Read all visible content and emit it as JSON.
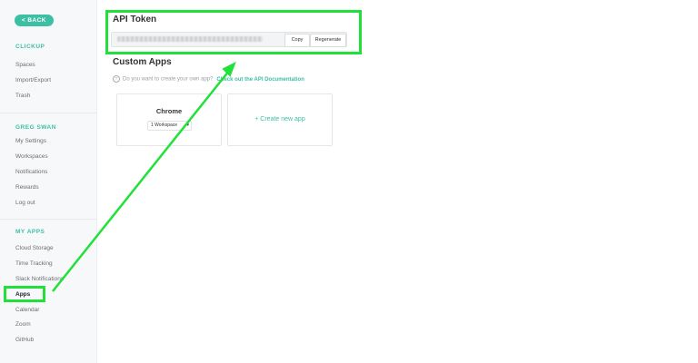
{
  "sidebar": {
    "back_label": "< BACK",
    "sections": [
      {
        "heading": "CLICKUP",
        "items": [
          "Spaces",
          "Import/Export",
          "Trash"
        ]
      },
      {
        "heading": "GREG SWAN",
        "items": [
          "My Settings",
          "Workspaces",
          "Notifications",
          "Rewards",
          "Log out"
        ]
      },
      {
        "heading": "MY APPS",
        "items": [
          "Cloud Storage",
          "Time Tracking",
          "Slack Notifications",
          "Apps",
          "Calendar",
          "Zoom",
          "GitHub"
        ]
      }
    ],
    "active_item": "Apps"
  },
  "api_token": {
    "title": "API Token",
    "copy_label": "Copy",
    "regenerate_label": "Regenerate"
  },
  "custom_apps": {
    "title": "Custom Apps",
    "info_text": "Do you want to create your own app?",
    "doc_link": "Check out the API Documentation",
    "cards": {
      "chrome": {
        "name": "Chrome",
        "workspace_select": "1 Workspace"
      },
      "create_label": "+ Create new app"
    }
  },
  "colors": {
    "accent": "#3dbfa4",
    "highlight": "#22e03a"
  },
  "icons": {
    "info": "info-icon",
    "chevron": "chevron-down-icon"
  }
}
